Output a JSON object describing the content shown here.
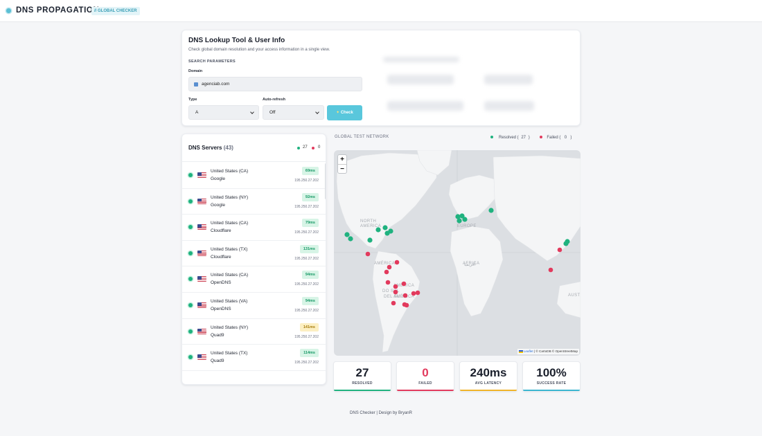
{
  "header": {
    "brand": "DNS PROPAGATION",
    "badge": "// GLOBAL CHECKER",
    "brand_icon": "globe-icon"
  },
  "lookup": {
    "title": "DNS Lookup Tool & User Info",
    "subtitle": "Check global domain resolution and your access information in a single view.",
    "section": "SEARCH PARAMETERS",
    "domain_label": "Domain",
    "domain_value": "agenciab.com",
    "type_label": "Type",
    "type_value": "A",
    "refresh_label": "Auto-refresh",
    "refresh_value": "Off",
    "check_label": "Check",
    "check_icon": "sparkle-icon"
  },
  "servers": {
    "title": "DNS Servers",
    "count": "(43)",
    "resolved_count": "27",
    "failed_count": "0",
    "items": [
      {
        "location": "United States (CA)",
        "provider": "Google",
        "latency": "69ms",
        "ip": "195.250.27.202",
        "slow": false
      },
      {
        "location": "United States (NY)",
        "provider": "Google",
        "latency": "92ms",
        "ip": "195.250.27.202",
        "slow": false
      },
      {
        "location": "United States (CA)",
        "provider": "Cloudflare",
        "latency": "79ms",
        "ip": "195.250.27.202",
        "slow": false
      },
      {
        "location": "United States (TX)",
        "provider": "Cloudflare",
        "latency": "131ms",
        "ip": "195.250.27.202",
        "slow": false
      },
      {
        "location": "United States (CA)",
        "provider": "OpenDNS",
        "latency": "94ms",
        "ip": "195.250.27.202",
        "slow": false
      },
      {
        "location": "United States (VA)",
        "provider": "OpenDNS",
        "latency": "94ms",
        "ip": "195.250.27.202",
        "slow": false
      },
      {
        "location": "United States (NY)",
        "provider": "Quad9",
        "latency": "141ms",
        "ip": "195.250.27.202",
        "slow": true
      },
      {
        "location": "United States (TX)",
        "provider": "Quad9",
        "latency": "114ms",
        "ip": "195.250.27.202",
        "slow": false
      }
    ]
  },
  "map": {
    "label": "GLOBAL TEST NETWORK",
    "legend_resolved": "Resolved (",
    "legend_resolved_count": "27",
    "legend_failed": "Failed (",
    "legend_failed_count": "0",
    "legend_close": ")",
    "zoom_in": "+",
    "zoom_out": "−",
    "attribution_leaflet": "Leaflet",
    "attribution_rest": " | © CartoDB © OpenStreetMap",
    "region_labels": [
      "NORTH",
      "AMERICA",
      "EUROPE",
      "AFRICA",
      "أفريقيا",
      "AMÉRICA",
      "AMÉRICA",
      "DO SUL",
      "AMÉRICA",
      "DEL SUR",
      "AUST"
    ]
  },
  "stats": [
    {
      "value": "27",
      "label": "RESOLVED",
      "color": "#1fb27f"
    },
    {
      "value": "0",
      "label": "FAILED",
      "color": "#e23a5d"
    },
    {
      "value": "240ms",
      "label": "AVG LATENCY",
      "color": "#f0b429"
    },
    {
      "value": "100%",
      "label": "SUCCESS RATE",
      "color": "#3bb6d0"
    }
  ],
  "footer": "DNS Checker | Design by BryanR",
  "colors": {
    "accent": "#59c7dc",
    "resolved": "#1fb27f",
    "failed": "#e23a5d",
    "slow": "#f0b429"
  }
}
